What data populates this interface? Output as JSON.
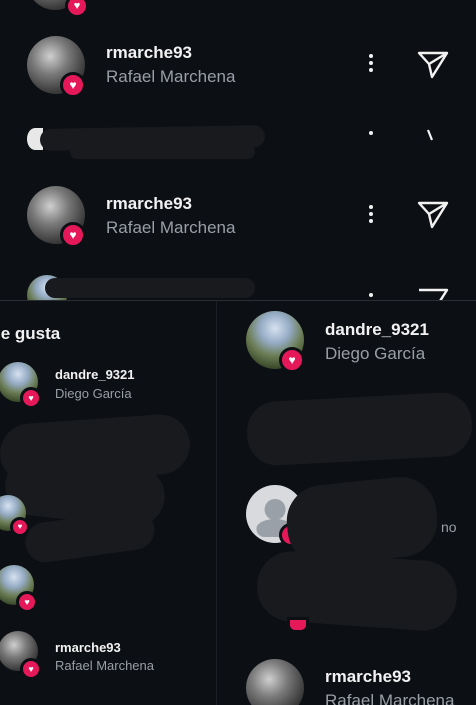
{
  "top_list": {
    "rows": [
      {
        "username": "rmarche93",
        "full_name": "Rafael Marchena"
      },
      {
        "username": "rmarche93",
        "full_name": "Rafael Marchena"
      }
    ]
  },
  "likes_panel": {
    "title": "le gusta",
    "rows": [
      {
        "username": "dandre_9321",
        "full_name": "Diego García"
      },
      {
        "username": "rmarche93",
        "full_name": "Rafael Marchena"
      }
    ]
  },
  "right_panel": {
    "rows": [
      {
        "username": "dandre_9321",
        "full_name": "Diego García"
      },
      {
        "username": "rmarche93",
        "full_name": "Rafael Marchena"
      }
    ],
    "fragment": "no"
  },
  "colors": {
    "heart_badge": "#e5195a",
    "background": "#0c0f14"
  },
  "icons": [
    "heart-icon",
    "more-options-icon",
    "send-icon",
    "default-avatar-icon"
  ]
}
